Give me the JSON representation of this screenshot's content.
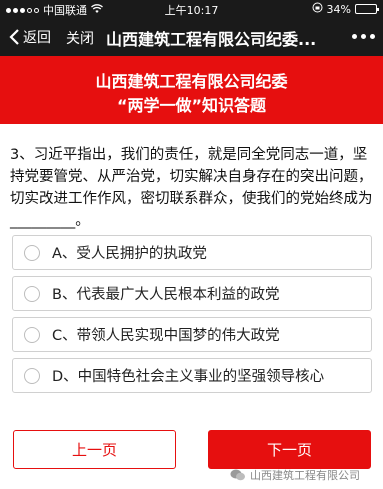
{
  "status_bar": {
    "carrier": "中国联通",
    "time": "上午10:17",
    "battery": "34%",
    "battery_level": 0.34
  },
  "nav": {
    "back_label": "返回",
    "close_label": "关闭",
    "title": "山西建筑工程有限公司纪委..."
  },
  "banner": {
    "line1": "山西建筑工程有限公司纪委",
    "line2": "“两学一做”知识答题"
  },
  "question": {
    "text": "3、习近平指出，我们的责任，就是同全党同志一道，坚持党要管党、从严治党，切实解决自身存在的突出问题，切实改进工作作风，密切联系群众，使我们的党始终成为_________。"
  },
  "options": [
    {
      "label": "A、受人民拥护的执政党"
    },
    {
      "label": "B、代表最广大人民根本利益的政党"
    },
    {
      "label": "C、带领人民实现中国梦的伟大政党"
    },
    {
      "label": "D、中国特色社会主义事业的坚强领导核心"
    }
  ],
  "buttons": {
    "prev_label": "上一页",
    "next_label": "下一页"
  },
  "watermark": {
    "text": "山西建筑工程有限公司"
  },
  "colors": {
    "accent": "#e60f0f",
    "nav_bg": "#1a1a1a"
  }
}
